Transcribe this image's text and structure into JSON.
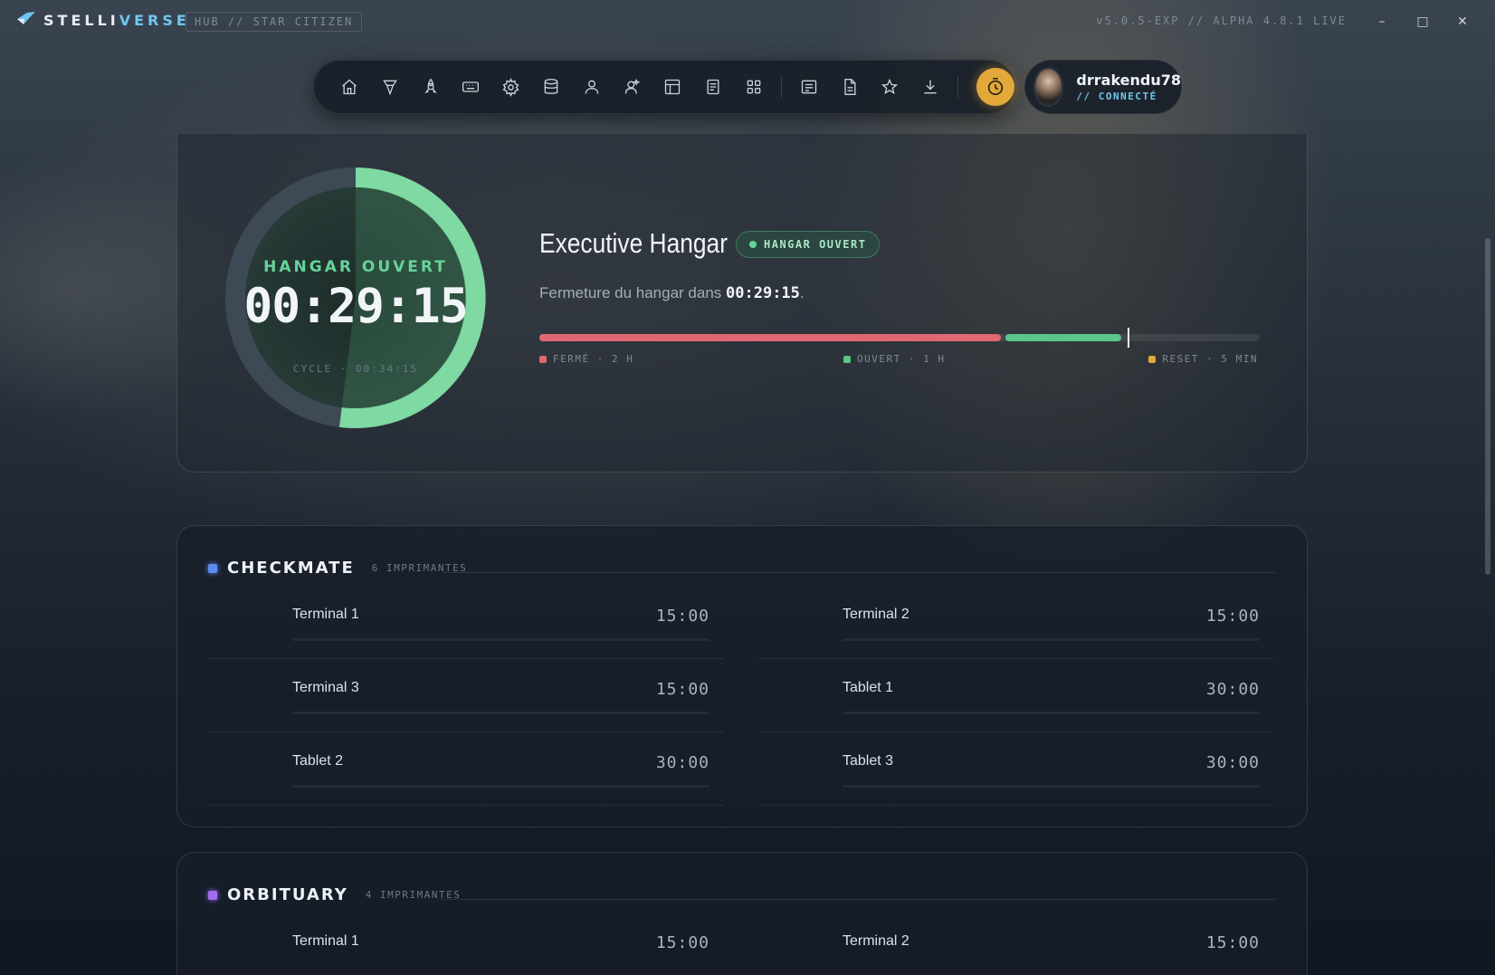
{
  "titlebar": {
    "brand_a": "STELLI",
    "brand_b": "VERSE",
    "hub_tag": "HUB // STAR CITIZEN",
    "version": "v5.0.5-EXP // ALPHA 4.8.1 LIVE",
    "minimize": "–",
    "maximize": "□",
    "close": "✕"
  },
  "nav": {
    "icons": [
      "home-icon",
      "ship-icon",
      "rocket-icon",
      "keyboard-icon",
      "settings-icon",
      "database-icon",
      "user-icon",
      "users-icon",
      "layout-icon",
      "document-icon",
      "grid-icon",
      "list-icon",
      "file-icon",
      "star-icon",
      "download-icon",
      "timer-icon"
    ]
  },
  "user": {
    "name": "drrakendu78",
    "status": "// CONNECTÉ"
  },
  "hero": {
    "ring_label": "HANGAR OUVERT",
    "ring_time": "00:29:15",
    "ring_cycle": "CYCLE · 00:34:15",
    "ring_progress": 0.52,
    "title": "Executive Hangar",
    "badge": "HANGAR OUVERT",
    "sub_prefix": "Fermeture du hangar dans ",
    "sub_time": "00:29:15",
    "sub_suffix": ".",
    "timeline": {
      "closed_fraction": 0.645,
      "open_fraction": 0.165,
      "marker_fraction": 0.817
    },
    "legend": [
      {
        "label": "FERMÉ · 2 H",
        "color": "#e06872"
      },
      {
        "label": "OUVERT · 1 H",
        "color": "#5bc68a"
      },
      {
        "label": "RESET · 5 MIN",
        "color": "#e2a83a"
      }
    ]
  },
  "sections": [
    {
      "title": "CHECKMATE",
      "count": "6 IMPRIMANTES",
      "color": "#5b8cf0",
      "printers": [
        {
          "name": "Terminal 1",
          "time": "15:00"
        },
        {
          "name": "Terminal 2",
          "time": "15:00"
        },
        {
          "name": "Terminal 3",
          "time": "15:00"
        },
        {
          "name": "Tablet 1",
          "time": "30:00"
        },
        {
          "name": "Tablet 2",
          "time": "30:00"
        },
        {
          "name": "Tablet 3",
          "time": "30:00"
        }
      ]
    },
    {
      "title": "ORBITUARY",
      "count": "4 IMPRIMANTES",
      "color": "#a56cf0",
      "printers": [
        {
          "name": "Terminal 1",
          "time": "15:00"
        },
        {
          "name": "Terminal 2",
          "time": "15:00"
        }
      ]
    }
  ]
}
